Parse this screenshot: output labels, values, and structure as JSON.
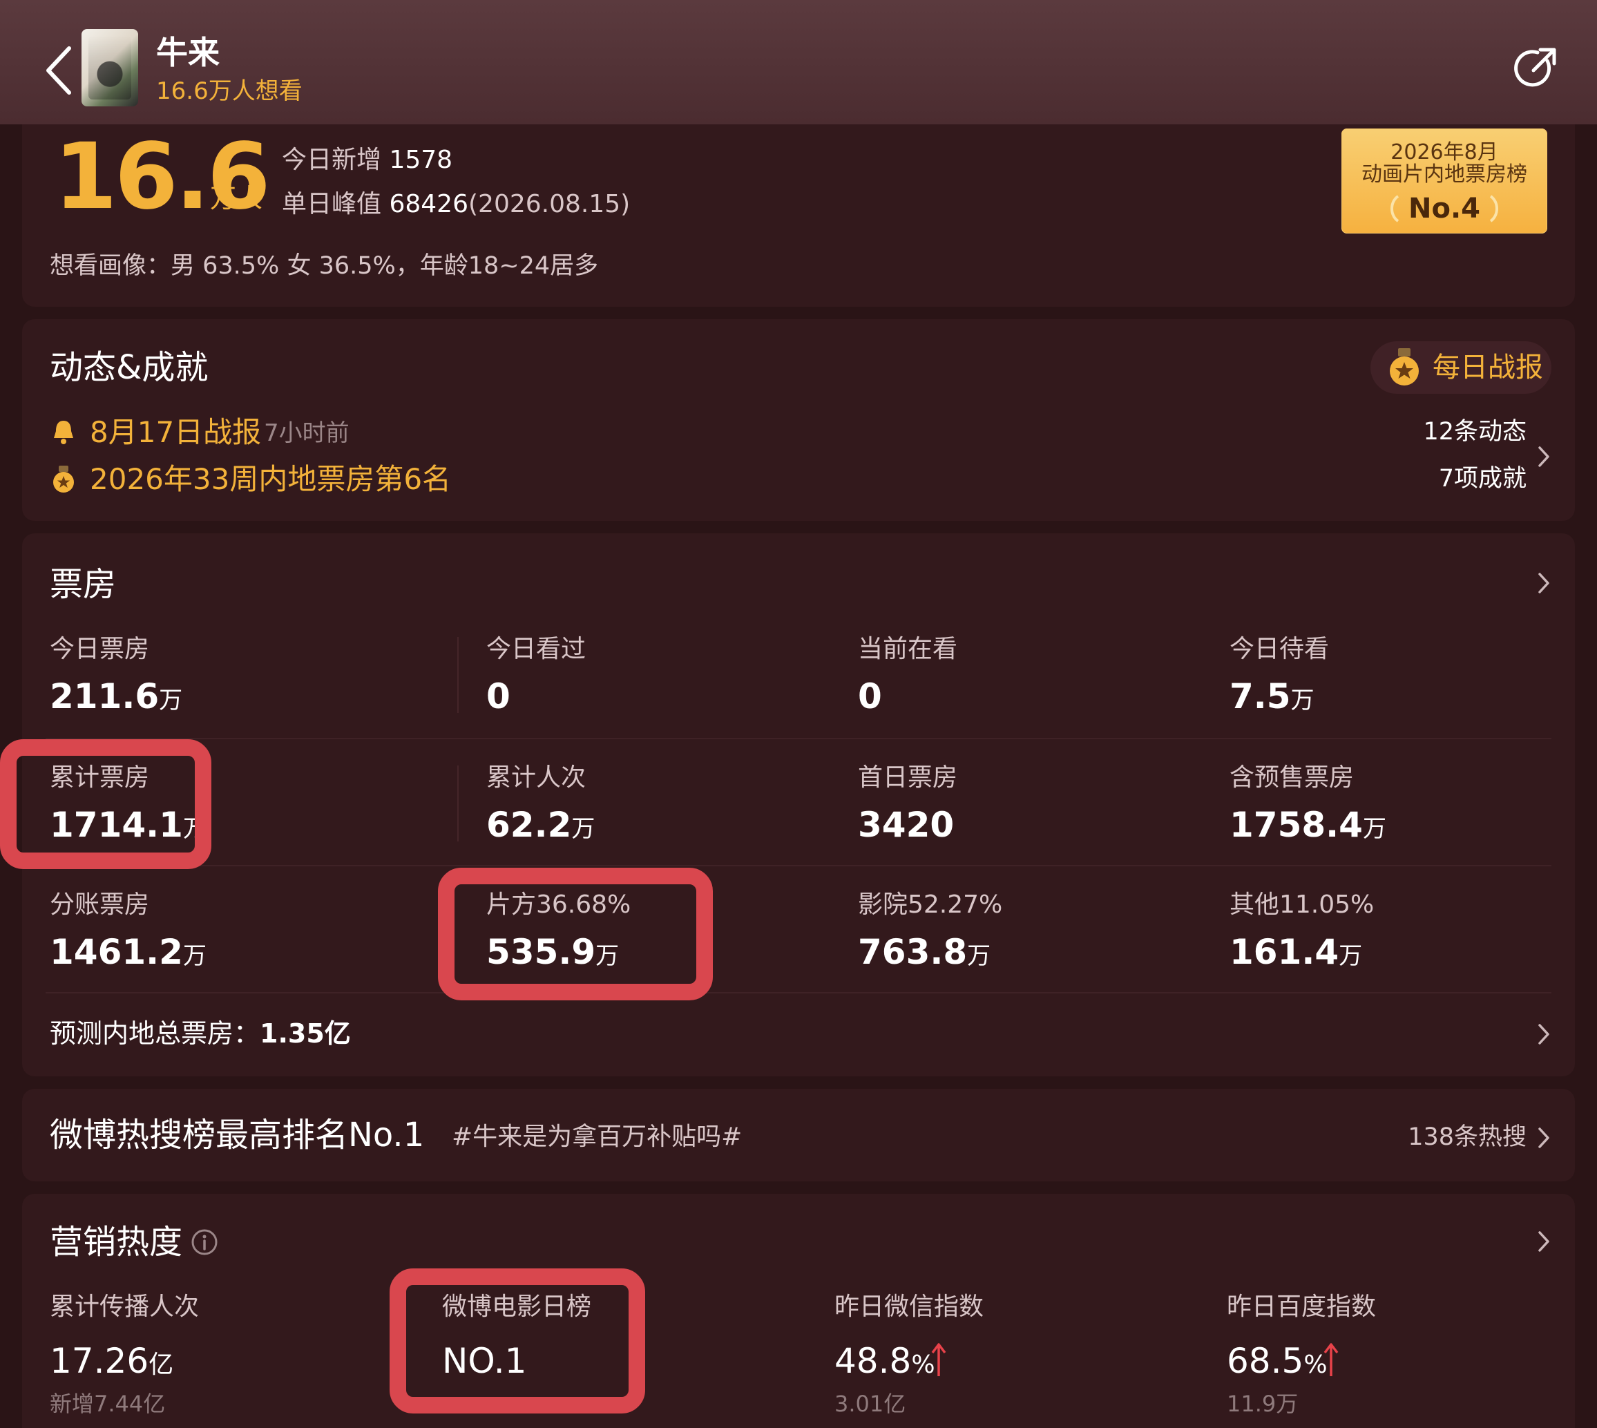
{
  "header": {
    "title": "牛来",
    "want_count": "16.6万人想看"
  },
  "summary": {
    "big_number": "16.6",
    "big_unit": "万人",
    "today_add_label": "今日新增",
    "today_add_value": "1578",
    "peak_label": "单日峰值",
    "peak_value": "68426",
    "peak_date": "(2026.08.15)",
    "demographic": "想看画像：男 63.5% 女 36.5%，年龄18~24居多"
  },
  "badge": {
    "line1": "2026年8月",
    "line2": "动画片内地票房榜",
    "rank": "No.4"
  },
  "dynamics": {
    "title": "动态&成就",
    "daily_report": "每日战报",
    "item1": "8月17日战报",
    "item1_time": "7小时前",
    "item2": "2026年33周内地票房第6名",
    "dynamic_count": "12条动态",
    "achievement_count": "7项成就"
  },
  "box_office": {
    "title": "票房",
    "rows": [
      [
        {
          "label": "今日票房",
          "value": "211.6",
          "unit": "万"
        },
        {
          "label": "今日看过",
          "value": "0",
          "unit": ""
        },
        {
          "label": "当前在看",
          "value": "0",
          "unit": ""
        },
        {
          "label": "今日待看",
          "value": "7.5",
          "unit": "万"
        }
      ],
      [
        {
          "label": "累计票房",
          "value": "1714.1",
          "unit": "万"
        },
        {
          "label": "累计人次",
          "value": "62.2",
          "unit": "万"
        },
        {
          "label": "首日票房",
          "value": "3420",
          "unit": ""
        },
        {
          "label": "含预售票房",
          "value": "1758.4",
          "unit": "万"
        }
      ],
      [
        {
          "label": "分账票房",
          "value": "1461.2",
          "unit": "万"
        },
        {
          "label": "片方36.68%",
          "value": "535.9",
          "unit": "万"
        },
        {
          "label": "影院52.27%",
          "value": "763.8",
          "unit": "万"
        },
        {
          "label": "其他11.05%",
          "value": "161.4",
          "unit": "万"
        }
      ]
    ],
    "forecast_label": "预测内地总票房：",
    "forecast_value": "1.35亿"
  },
  "weibo": {
    "title": "微博热搜榜最高排名No.1",
    "tag": "#牛来是为拿百万补贴吗#",
    "count": "138条热搜"
  },
  "marketing": {
    "title": "营销热度",
    "items": [
      {
        "label": "累计传播人次",
        "value": "17.26",
        "unit": "亿",
        "sub": "新增7.44亿"
      },
      {
        "label": "微博电影日榜",
        "value": "NO.1",
        "unit": "",
        "sub": ""
      },
      {
        "label": "昨日微信指数",
        "value": "48.8",
        "unit": "%",
        "sub": "3.01亿"
      },
      {
        "label": "昨日百度指数",
        "value": "68.5",
        "unit": "%",
        "sub": "11.9万"
      }
    ]
  },
  "colors": {
    "accent": "#f3b23a",
    "background": "#2a1416",
    "card": "#33191c",
    "highlight": "#d9474e",
    "up_arrow": "#e8424a"
  }
}
